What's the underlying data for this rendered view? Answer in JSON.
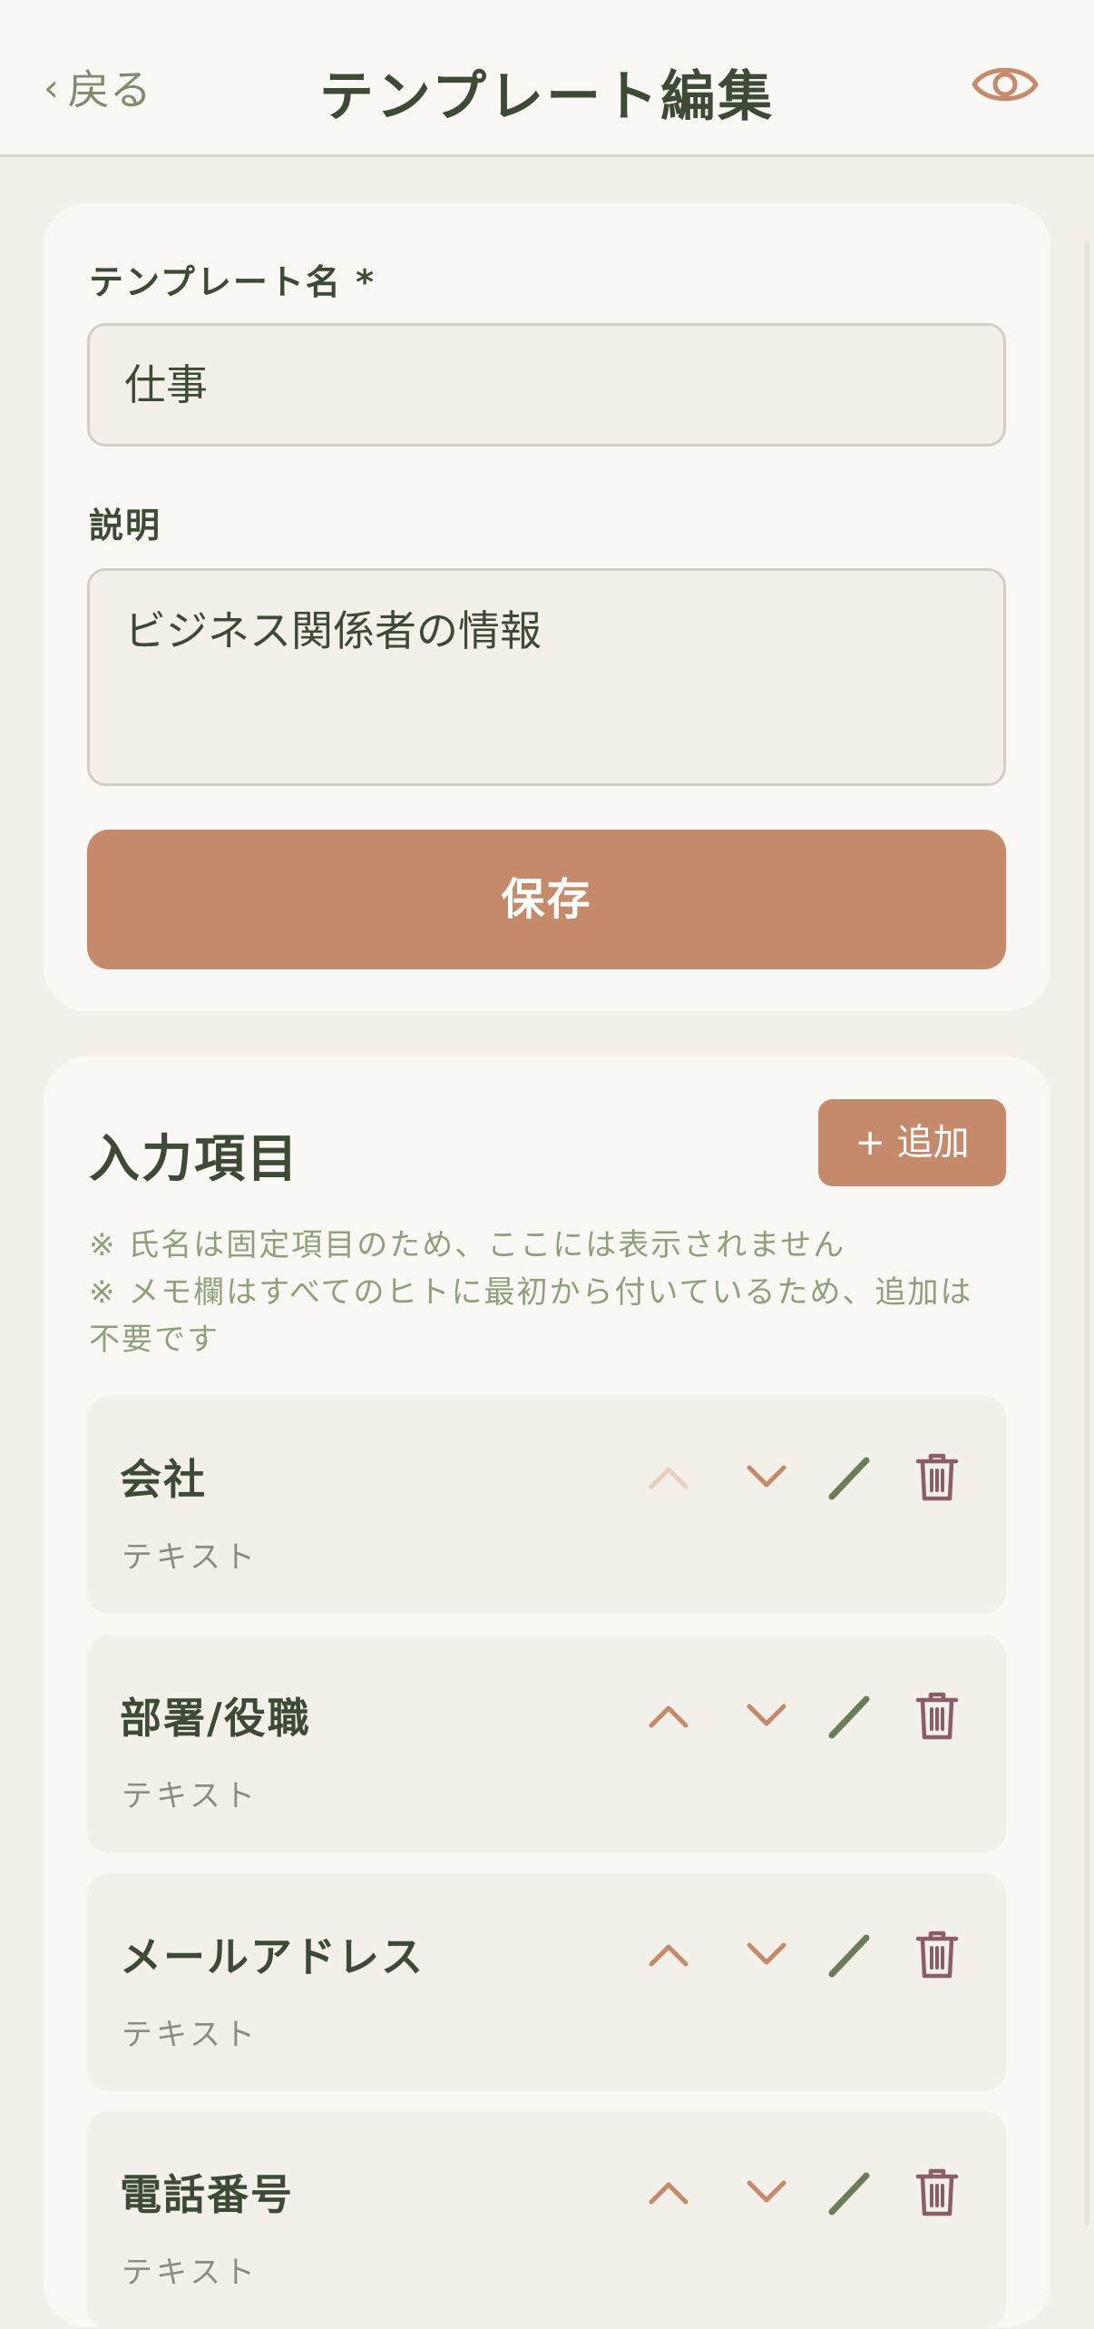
{
  "header": {
    "back_label": "戻る",
    "title": "テンプレート編集",
    "preview_icon": "eye-icon"
  },
  "template": {
    "name_label": "テンプレート名 *",
    "name_value": "仕事",
    "description_label": "説明",
    "description_value": "ビジネス関係者の情報",
    "save_label": "保存"
  },
  "fields_section": {
    "title": "入力項目",
    "add_label": "+ 追加",
    "notes": [
      "※ 氏名は固定項目のため、ここには表示されません",
      "※ メモ欄はすべてのヒトに最初から付いているため、追加は不要です"
    ],
    "items": [
      {
        "name": "会社",
        "type": "テキスト",
        "move_up_enabled": false
      },
      {
        "name": "部署/役職",
        "type": "テキスト",
        "move_up_enabled": true
      },
      {
        "name": "メールアドレス",
        "type": "テキスト",
        "move_up_enabled": true
      },
      {
        "name": "電話番号",
        "type": "テキスト",
        "move_up_enabled": true
      }
    ]
  },
  "colors": {
    "accent": "#c5896b",
    "accent_disabled": "#e8cfbf",
    "edit_icon": "#6b7d57",
    "delete_icon": "#8a5e68",
    "title_text": "#3c4a36",
    "muted_green": "#8fa17c",
    "background": "#f3f0ea",
    "card": "#faf8f4"
  }
}
